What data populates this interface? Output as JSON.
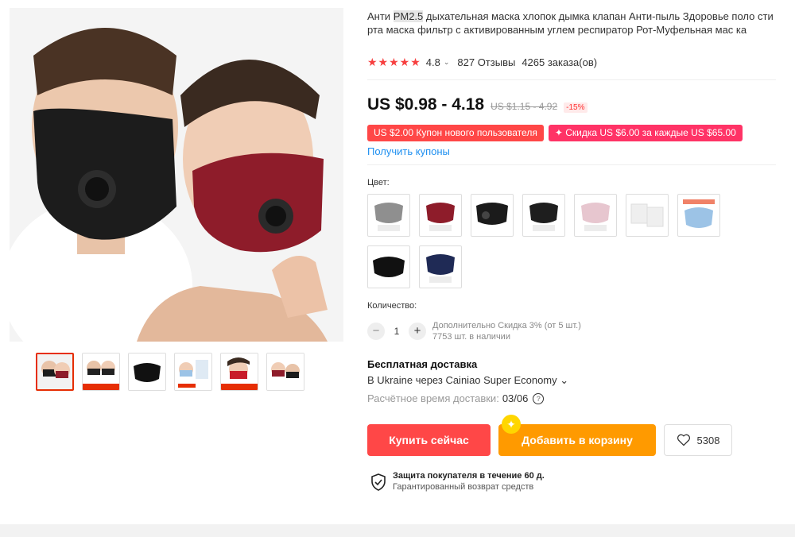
{
  "product": {
    "title_prefix": "Анти ",
    "title_highlight": "PM2.5",
    "title_rest": " дыхательная маска хлопок дымка клапан Анти-пыль Здоровье поло сти рта маска фильтр с активированным углем респиратор Рот-Муфельная мас ка"
  },
  "rating": {
    "stars": "★★★★★",
    "score": "4.8",
    "reviews": "827 Отзывы",
    "orders": "4265 заказа(ов)"
  },
  "price": {
    "current": "US $0.98 - 4.18",
    "old": "US $1.15 - 4.92",
    "discount": "-15%"
  },
  "coupons": {
    "new_user": "US $2.00 Купон нового пользователя",
    "store": "✦ Скидка US $6.00 за каждые US $65.00",
    "get_link": "Получить купоны"
  },
  "color_label": "Цвет:",
  "quantity": {
    "label": "Количество:",
    "minus": "−",
    "value": "1",
    "plus": "+",
    "extra_discount": "Дополнительно Скидка 3% (от 5 шт.)",
    "stock": "7753 шт. в наличии"
  },
  "shipping": {
    "title": "Бесплатная доставка",
    "via": "В Ukraine через Cainiao Super Economy ⌄",
    "eta_label": "Расчётное время доставки:",
    "eta_value": "03/06",
    "help_glyph": "?"
  },
  "actions": {
    "buy": "Купить сейчас",
    "cart": "Добавить в корзину",
    "cart_badge": "✦",
    "wishlist_count": "5308"
  },
  "protection": {
    "title": "Защита покупателя в течение 60 д.",
    "subtitle": "Гарантированный возврат средств"
  },
  "swatch_colors": [
    "#8f8f8f",
    "#8e1c2a",
    "#1b1b1b",
    "#1e1e1e",
    "#e7c6cf",
    "#efefef",
    "#9cc3e6",
    "#111111",
    "#1f2a55"
  ],
  "thumb_icons": [
    "couple-mask-thumb",
    "couple-mask-thumb-2",
    "black-mask-thumb",
    "blue-mask-thumb",
    "red-mask-thumb",
    "couple-mask-thumb-3"
  ],
  "colors": {
    "accent_red": "#ff4747",
    "accent_orange": "#ff9a00",
    "link_blue": "#1d8ff0",
    "star_red": "#f73f3f"
  }
}
